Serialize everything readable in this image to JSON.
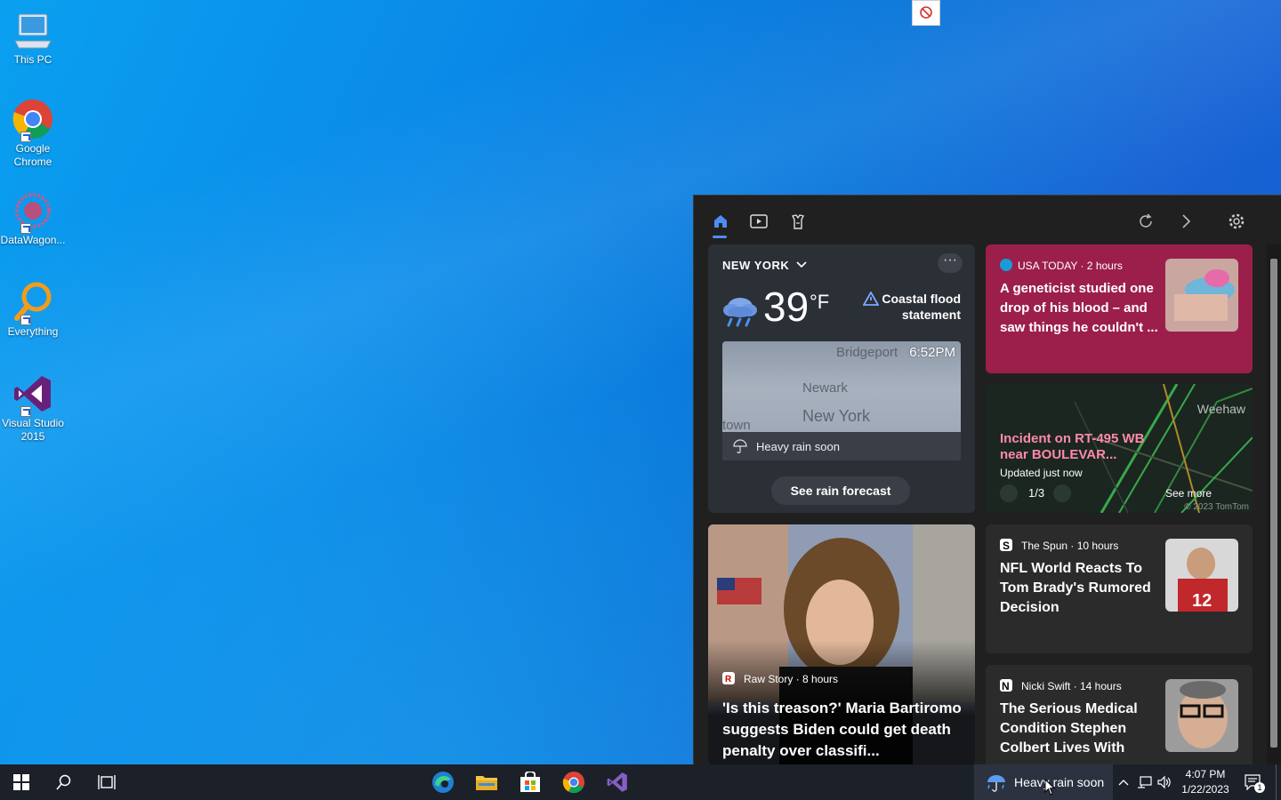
{
  "desktop": {
    "icons": [
      {
        "label": "This PC"
      },
      {
        "label": "Google Chrome"
      },
      {
        "label": "DataWagon..."
      },
      {
        "label": "Everything"
      },
      {
        "label": "Visual Studio 2015"
      }
    ]
  },
  "widget": {
    "weather": {
      "location": "NEW YORK",
      "more": "···",
      "temperature": "39",
      "unit": "°F",
      "alert": "Coastal flood statement",
      "map_time": "6:52PM",
      "map_places": [
        "Bridgeport",
        "Newark",
        "New York",
        "town"
      ],
      "rain_status": "Heavy rain soon",
      "button": "See rain forecast"
    },
    "top_story": {
      "source": "USA TODAY · 2 hours",
      "headline": "A geneticist studied one drop of his blood – and saw things he couldn't ..."
    },
    "traffic": {
      "title": "Incident on RT-495 WB near BOULEVAR...",
      "updated": "Updated just now",
      "page": "1/3",
      "see_more": "See more",
      "place": "Weehaw",
      "copyright": "© 2023 TomTom"
    },
    "big_story": {
      "source": "Raw Story · 8 hours",
      "headline": "'Is this treason?' Maria Bartiromo suggests Biden could get death penalty over classifi..."
    },
    "story2": {
      "source": "The Spun · 10 hours",
      "headline": "NFL World Reacts To Tom Brady's Rumored Decision"
    },
    "story3": {
      "source": "Nicki Swift · 14 hours",
      "headline": "The Serious Medical Condition Stephen Colbert Lives With"
    }
  },
  "taskbar": {
    "weather_text": "Heavy rain soon",
    "time": "4:07 PM",
    "date": "1/22/2023",
    "notification_count": "1"
  },
  "colors": {
    "accent": "#4c8df6",
    "top_story_bg": "#9c1f4b",
    "traffic_title": "#ff8aa8"
  }
}
